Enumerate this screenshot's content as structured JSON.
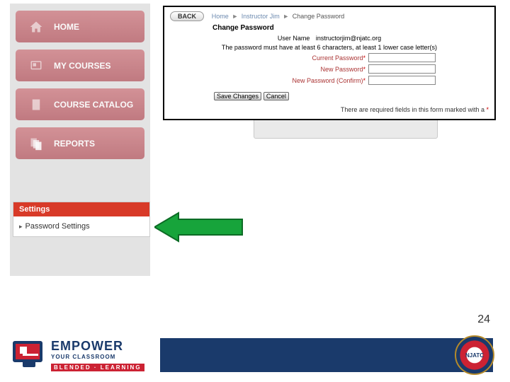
{
  "sidebar": {
    "items": [
      {
        "label": "HOME",
        "icon": "home-icon"
      },
      {
        "label": "MY COURSES",
        "icon": "courses-icon"
      },
      {
        "label": "COURSE CATALOG",
        "icon": "catalog-icon"
      },
      {
        "label": "REPORTS",
        "icon": "reports-icon"
      }
    ]
  },
  "settings": {
    "header": "Settings",
    "item": "Password Settings"
  },
  "dialog": {
    "back": "BACK",
    "breadcrumb_home": "Home",
    "breadcrumb_user": "Instructor Jim",
    "breadcrumb_current": "Change Password",
    "title": "Change Password",
    "username_label": "User Name",
    "username_value": "instructorjim@njatc.org",
    "hint": "The password must have at least 6 characters, at least 1 lower case letter(s)",
    "current_pw": "Current Password",
    "new_pw": "New Password",
    "confirm_pw": "New Password (Confirm)",
    "save": "Save Changes",
    "cancel": "Cancel",
    "required_note": "There are required fields in this form marked with a "
  },
  "page_number": "24",
  "logo": {
    "line1": "EMPOWER",
    "line2": "YOUR CLASSROOM",
    "line3": "BLENDED · LEARNING"
  },
  "seal": "NJATC"
}
